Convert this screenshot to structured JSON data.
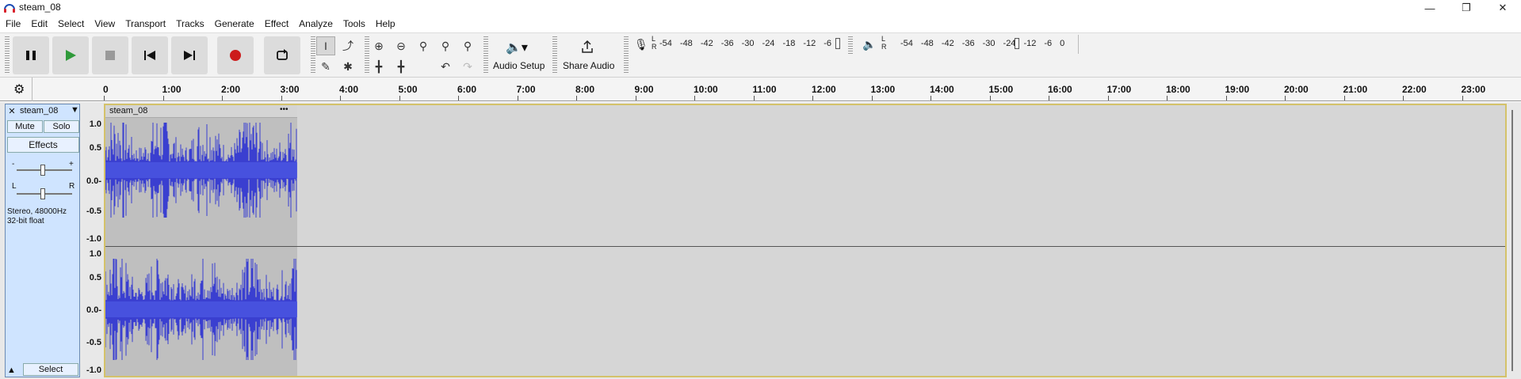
{
  "window": {
    "title": "steam_08",
    "minimize_icon": "minimize-icon",
    "maximize_icon": "restore-icon",
    "close_icon": "close-icon"
  },
  "menu": [
    "File",
    "Edit",
    "Select",
    "View",
    "Transport",
    "Tracks",
    "Generate",
    "Effect",
    "Analyze",
    "Tools",
    "Help"
  ],
  "toolbar": {
    "audio_setup_label": "Audio Setup",
    "share_audio_label": "Share Audio",
    "record_meter_labels": [
      "-54",
      "-48",
      "-42",
      "-36",
      "-30",
      "-24",
      "-18",
      "-12",
      "-6"
    ],
    "play_meter_labels": [
      "-54",
      "-48",
      "-42",
      "-36",
      "-30",
      "-24",
      "-12",
      "-6",
      "0"
    ],
    "lr": [
      "L",
      "R"
    ]
  },
  "ruler": {
    "labels": [
      "0",
      "1:00",
      "2:00",
      "3:00",
      "4:00",
      "5:00",
      "6:00",
      "7:00",
      "8:00",
      "9:00",
      "10:00",
      "11:00",
      "12:00",
      "13:00",
      "14:00",
      "15:00",
      "16:00",
      "17:00",
      "18:00",
      "19:00",
      "20:00",
      "21:00",
      "22:00",
      "23:00"
    ]
  },
  "track": {
    "name": "steam_08",
    "mute_label": "Mute",
    "solo_label": "Solo",
    "effects_label": "Effects",
    "gain_minus": "-",
    "gain_plus": "+",
    "pan_left": "L",
    "pan_right": "R",
    "format_line1": "Stereo, 48000Hz",
    "format_line2": "32-bit float",
    "select_label": "Select",
    "clip_name": "steam_08",
    "clip_menu": "•••",
    "scale_top": [
      "1.0",
      "0.5",
      "0.0-",
      "-0.5",
      "-1.0"
    ],
    "scale_bottom": [
      "1.0",
      "0.5",
      "0.0-",
      "-0.5",
      "-1.0"
    ]
  },
  "colors": {
    "waveform": "#3a3fd0",
    "track_panel": "#cfe4ff",
    "clip_bg": "#bfbfbf",
    "selection_border": "#d4c26a",
    "record_red": "#cc1b1b",
    "play_green": "#2f9a3a"
  }
}
